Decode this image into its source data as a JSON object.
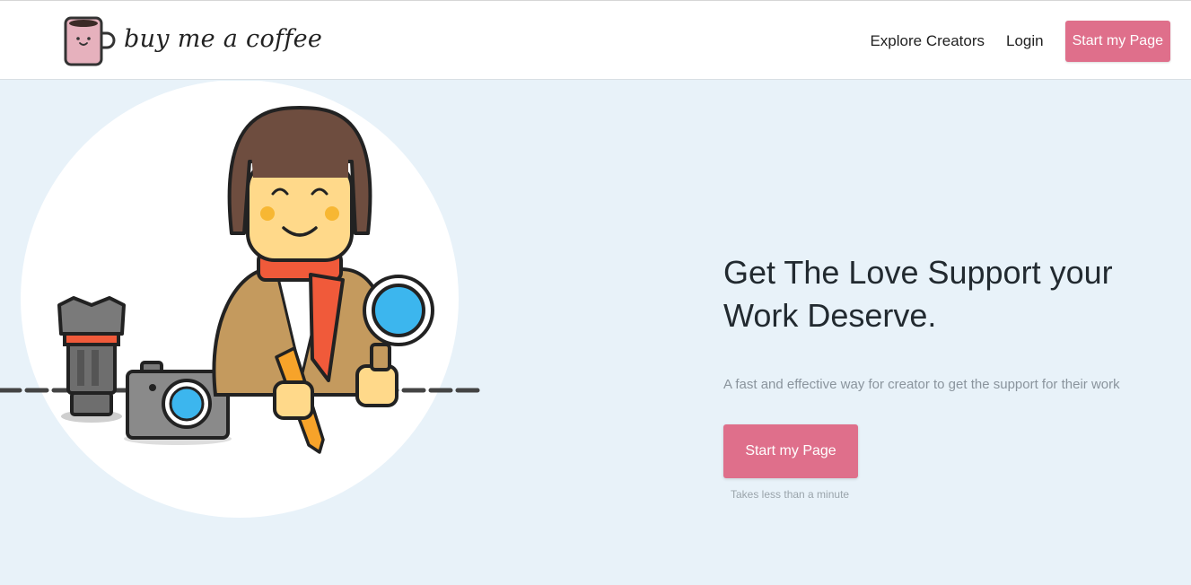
{
  "header": {
    "logo_text": "buy me a coffee",
    "nav": [
      {
        "label": "Explore Creators"
      },
      {
        "label": "Login"
      }
    ],
    "cta_label": "Start my Page"
  },
  "hero": {
    "headline_line1": "Get The Love Support your",
    "headline_line2": "Work Deserve.",
    "subtext": "A fast and effective way for creator to get the support for their work",
    "cta_label": "Start my Page",
    "note": "Takes less than a minute"
  },
  "colors": {
    "accent": "#df6f8b",
    "hero_background": "#e8f2f9",
    "headline": "#222a30",
    "subtext": "#8a949d"
  },
  "icons": [
    "coffee-cup-logo-icon",
    "creator-illustration"
  ]
}
